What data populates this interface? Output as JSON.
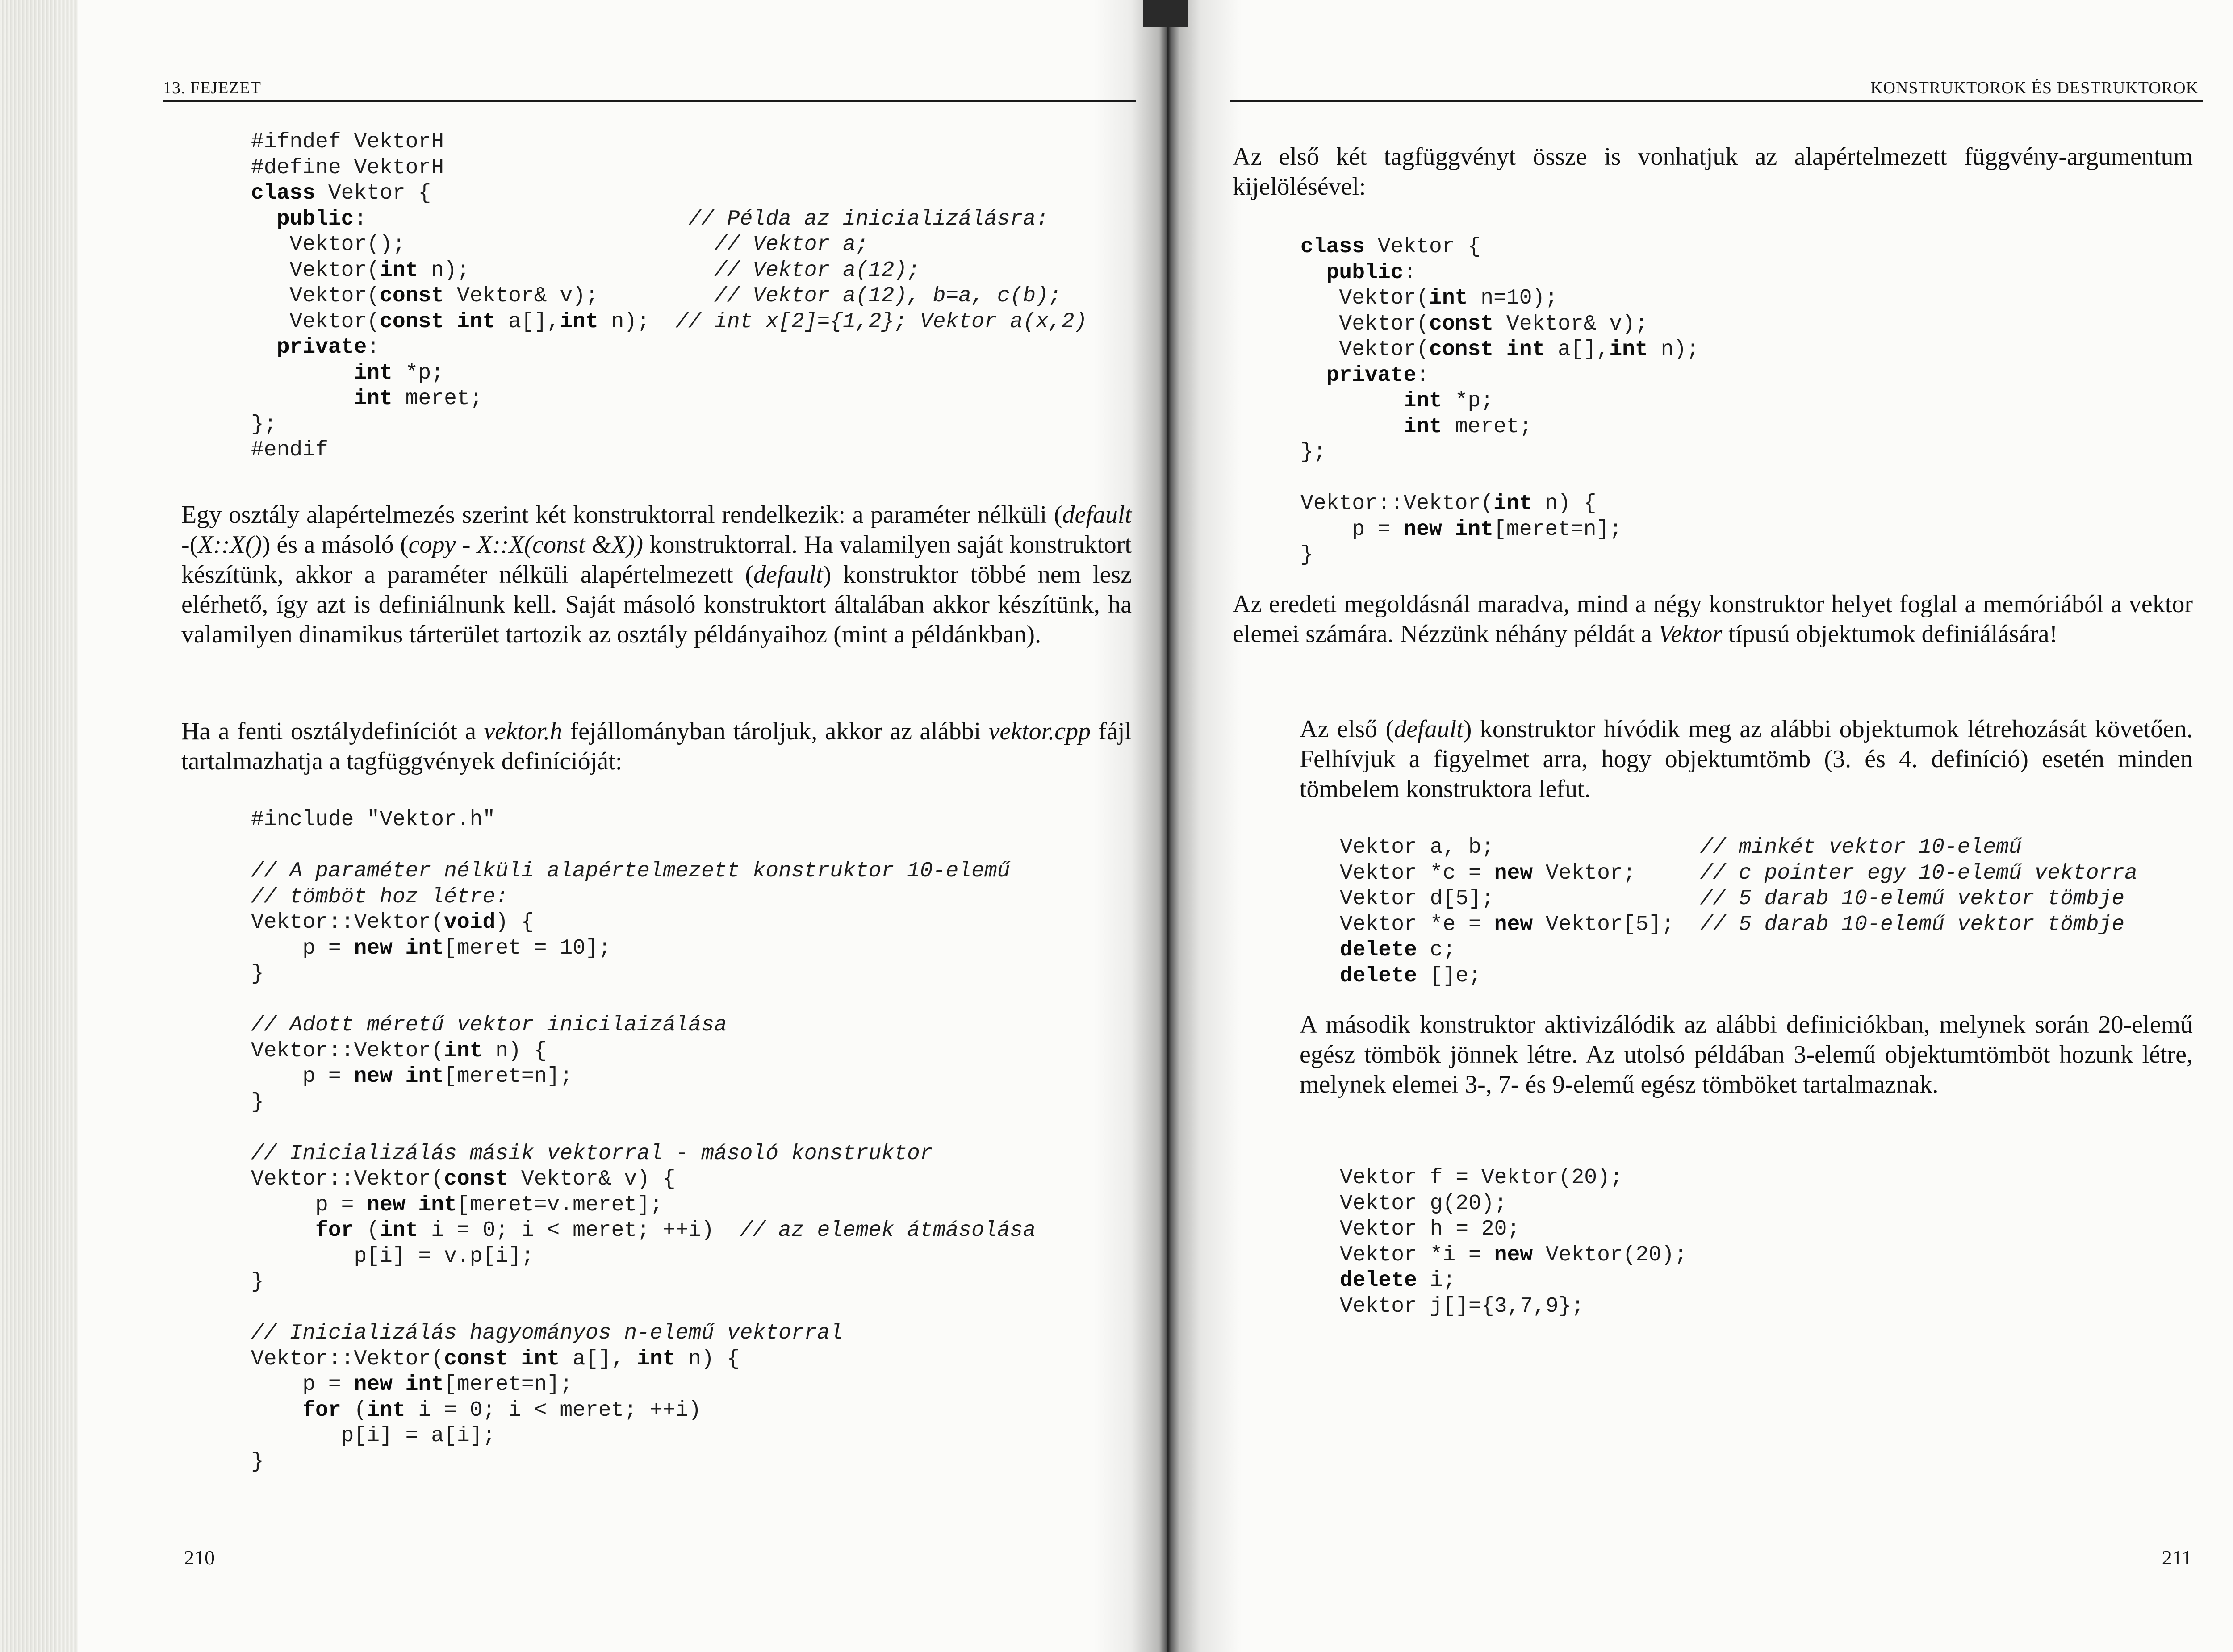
{
  "left_page": {
    "running_head": "13. FEJEZET",
    "page_number": "210",
    "code_header": [
      [
        "#ifndef VektorH"
      ],
      [
        "#define VektorH"
      ],
      [
        "**class** Vektor {"
      ],
      [
        "  **public**:                         ",
        "*// Példa az inicializálásra:*"
      ],
      [
        "   Vektor();                        ",
        "*// Vektor a;*"
      ],
      [
        "   Vektor(**int** n);                   ",
        "*// Vektor a(12);*"
      ],
      [
        "   Vektor(**const** Vektor& v);         ",
        "*// Vektor a(12), b=a, c(b);*"
      ],
      [
        "   Vektor(**const** **int** a[],**int** n);  ",
        "*// int x[2]={1,2}; Vektor a(x,2)*"
      ],
      [
        "  **private**:"
      ],
      [
        "        **int** *p;"
      ],
      [
        "        **int** meret;"
      ],
      [
        "};"
      ],
      [
        "#endif"
      ]
    ],
    "para1": [
      {
        "t": "Egy osztály alapértelmezés szerint két konstruktorral rendelkezik: a paraméter nélküli ("
      },
      {
        "t": "default",
        "i": true
      },
      {
        "t": " -("
      },
      {
        "t": "X::X()",
        "i": true
      },
      {
        "t": ") és a másoló ("
      },
      {
        "t": "copy - X::X(const &X))",
        "i": true
      },
      {
        "t": " konstruktorral. Ha valamilyen saját konstruktort készítünk, akkor a paraméter nélküli alapértelmezett ("
      },
      {
        "t": "default",
        "i": true
      },
      {
        "t": ") konstruktor többé nem lesz elérhető, így azt is definiálnunk kell. Saját másoló konstruktort általában akkor készítünk, ha valamilyen dinamikus tárterület tartozik az osztály példányaihoz (mint a példánkban)."
      }
    ],
    "para2": [
      {
        "t": "Ha a fenti osztálydefiníciót a "
      },
      {
        "t": "vektor.h",
        "i": true
      },
      {
        "t": " fejállományban tároljuk, akkor az alábbi "
      },
      {
        "t": "vektor.cpp",
        "i": true
      },
      {
        "t": " fájl tartalmazhatja a tagfüggvények definícióját:"
      }
    ],
    "code_impl": [
      [
        "#include \"Vektor.h\""
      ],
      [
        ""
      ],
      [
        "*// A paraméter nélküli alapértelmezett konstruktor 10-elemű*"
      ],
      [
        "*// tömböt hoz létre:*"
      ],
      [
        "Vektor::Vektor(**void**) {"
      ],
      [
        "    p = **new** **int**[meret = 10];"
      ],
      [
        "}"
      ],
      [
        ""
      ],
      [
        "*// Adott méretű vektor inicilaizálása*"
      ],
      [
        "Vektor::Vektor(**int** n) {"
      ],
      [
        "    p = **new** **int**[meret=n];"
      ],
      [
        "}"
      ],
      [
        ""
      ],
      [
        "*// Inicializálás másik vektorral - másoló konstruktor*"
      ],
      [
        "Vektor::Vektor(**const** Vektor& v) {"
      ],
      [
        "     p = **new** **int**[meret=v.meret];"
      ],
      [
        "     **for** (**int** i = 0; i < meret; ++i)  ",
        "*// az elemek átmásolása*"
      ],
      [
        "        p[i] = v.p[i];"
      ],
      [
        "}"
      ],
      [
        ""
      ],
      [
        "*// Inicializálás hagyományos n-elemű vektorral*"
      ],
      [
        "Vektor::Vektor(**const** **int** a[], **int** n) {"
      ],
      [
        "    p = **new** **int**[meret=n];"
      ],
      [
        "    **for** (**int** i = 0; i < meret; ++i)"
      ],
      [
        "       p[i] = a[i];"
      ],
      [
        "}"
      ]
    ]
  },
  "right_page": {
    "running_head": "KONSTRUKTOROK ÉS DESTRUKTOROK",
    "page_number": "211",
    "para1": [
      {
        "t": "Az első két tagfüggvényt össze is vonhatjuk az alapértelmezett függvény-argumentum kijelölésével:"
      }
    ],
    "code_class": [
      [
        "**class** Vektor {"
      ],
      [
        "  **public**:"
      ],
      [
        "   Vektor(**int** n=10);"
      ],
      [
        "   Vektor(**const** Vektor& v);"
      ],
      [
        "   Vektor(**const** **int** a[],**int** n);"
      ],
      [
        "  **private**:"
      ],
      [
        "        **int** *p;"
      ],
      [
        "        **int** meret;"
      ],
      [
        "};"
      ],
      [
        ""
      ],
      [
        "Vektor::Vektor(**int** n) {"
      ],
      [
        "    p = **new** **int**[meret=n];"
      ],
      [
        "}"
      ]
    ],
    "para2": [
      {
        "t": "Az eredeti megoldásnál maradva, mind a négy konstruktor helyet foglal a memóriából a vektor elemei számára. Nézzünk néhány példát a "
      },
      {
        "t": "Vektor",
        "i": true
      },
      {
        "t": " típusú objektumok definiálására!"
      }
    ],
    "para3": [
      {
        "t": "Az első ("
      },
      {
        "t": "default",
        "i": true
      },
      {
        "t": ") konstruktor hívódik meg az alábbi objektumok létrehozását követően. Felhívjuk a figyelmet arra, hogy objektumtömb (3. és 4. definíció) esetén minden tömbelem konstruktora lefut."
      }
    ],
    "code_ex1": [
      [
        "Vektor a, b;                ",
        "*// minkét vektor 10-elemű*"
      ],
      [
        "Vektor *c = **new** Vektor;     ",
        "*// c pointer egy 10-elemű vektorra*"
      ],
      [
        "Vektor d[5];                ",
        "*// 5 darab 10-elemű vektor tömbje*"
      ],
      [
        "Vektor *e = **new** Vektor[5];  ",
        "*// 5 darab 10-elemű vektor tömbje*"
      ],
      [
        "**delete** c;"
      ],
      [
        "**delete** []e;"
      ]
    ],
    "para4": [
      {
        "t": "A második konstruktor aktivizálódik az alábbi definiciókban, melynek során 20-elemű egész tömbök jönnek létre. Az utolsó példában 3-elemű objektumtömböt hozunk létre, melynek elemei 3-, 7- és 9-elemű egész tömböket tartalmaznak."
      }
    ],
    "code_ex2": [
      [
        "Vektor f = Vektor(20);"
      ],
      [
        "Vektor g(20);"
      ],
      [
        "Vektor h = 20;"
      ],
      [
        "Vektor *i = **new** Vektor(20);"
      ],
      [
        "**delete** i;"
      ],
      [
        "Vektor j[]={3,7,9};"
      ]
    ]
  }
}
